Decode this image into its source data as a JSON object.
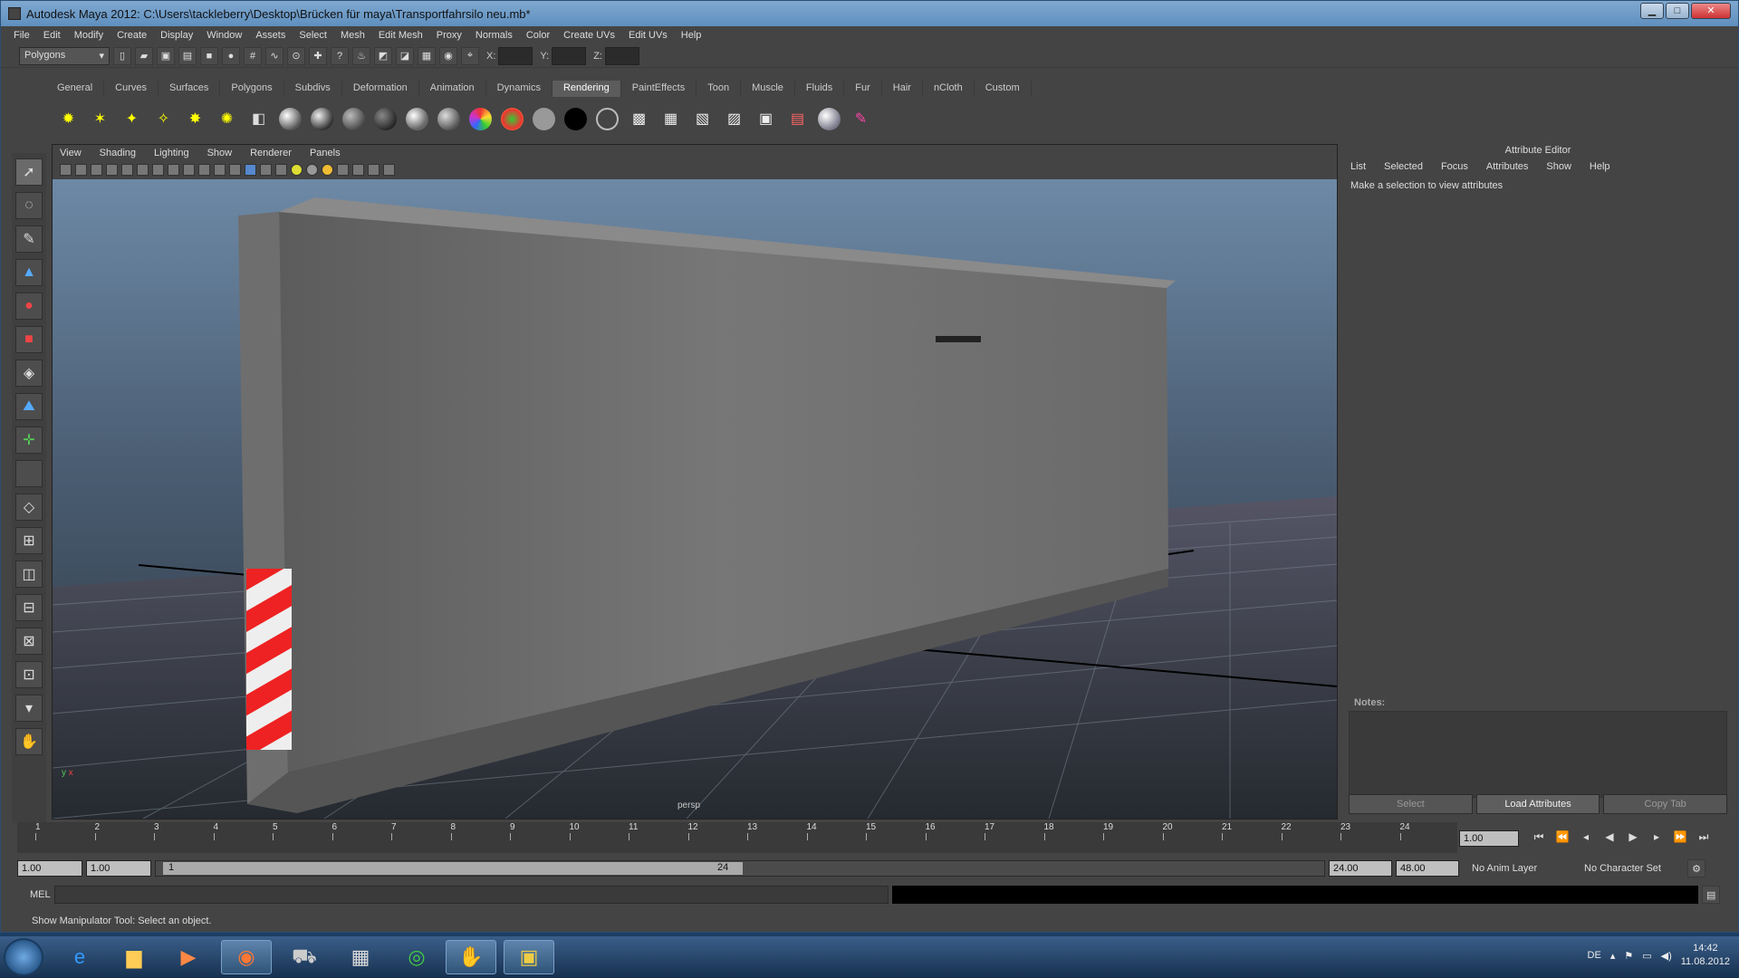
{
  "window": {
    "title": "Autodesk Maya 2012: C:\\Users\\tackleberry\\Desktop\\Brücken für maya\\Transportfahrsilo neu.mb*",
    "minimize": "▁",
    "maximize": "□",
    "close": "✕"
  },
  "menus": [
    "File",
    "Edit",
    "Modify",
    "Create",
    "Display",
    "Window",
    "Assets",
    "Select",
    "Mesh",
    "Edit Mesh",
    "Proxy",
    "Normals",
    "Color",
    "Create UVs",
    "Edit UVs",
    "Help"
  ],
  "status": {
    "mode": "Polygons",
    "x_label": "X:",
    "y_label": "Y:",
    "z_label": "Z:"
  },
  "shelf_tabs": [
    "General",
    "Curves",
    "Surfaces",
    "Polygons",
    "Subdivs",
    "Deformation",
    "Animation",
    "Dynamics",
    "Rendering",
    "PaintEffects",
    "Toon",
    "Muscle",
    "Fluids",
    "Fur",
    "Hair",
    "nCloth",
    "Custom"
  ],
  "shelf_active": "Rendering",
  "viewport": {
    "menus": [
      "View",
      "Shading",
      "Lighting",
      "Show",
      "Renderer",
      "Panels"
    ],
    "camera_label": "persp",
    "axis_y": "y",
    "axis_x": "x"
  },
  "attribute_editor": {
    "title": "Attribute Editor",
    "menus": [
      "List",
      "Selected",
      "Focus",
      "Attributes",
      "Show",
      "Help"
    ],
    "message": "Make a selection to view attributes",
    "notes_label": "Notes:",
    "buttons": {
      "select": "Select",
      "load": "Load Attributes",
      "copy": "Copy Tab"
    }
  },
  "timeline": {
    "ticks": [
      "1",
      "2",
      "3",
      "4",
      "5",
      "6",
      "7",
      "8",
      "9",
      "10",
      "11",
      "12",
      "13",
      "14",
      "15",
      "16",
      "17",
      "18",
      "19",
      "20",
      "21",
      "22",
      "23",
      "24"
    ],
    "current_time": "1.00"
  },
  "range": {
    "start": "1.00",
    "inner_start": "1.00",
    "slider_start": "1",
    "slider_end": "24",
    "end": "24.00",
    "outer_end": "48.00",
    "anim_layer": "No Anim Layer",
    "char_set": "No Character Set"
  },
  "command": {
    "label": "MEL"
  },
  "helpline": "Show Manipulator Tool: Select an object.",
  "taskbar": {
    "lang": "DE",
    "time": "14:42",
    "date": "11.08.2012"
  }
}
